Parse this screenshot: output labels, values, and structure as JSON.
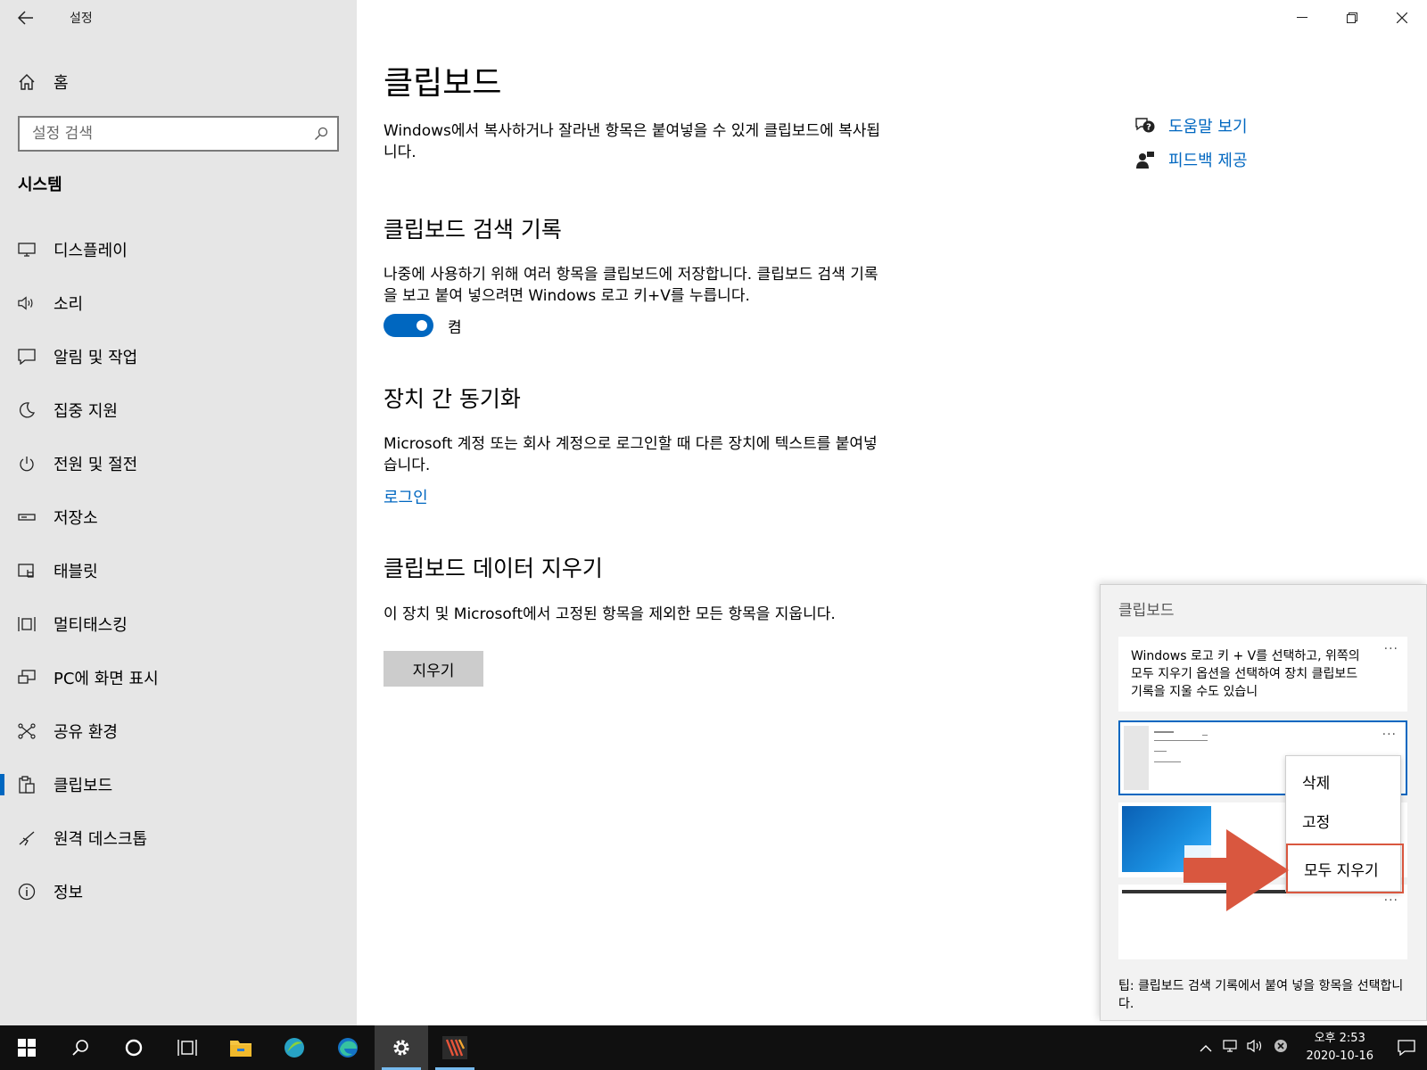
{
  "window": {
    "title": "설정",
    "back_label": "←",
    "minimize": "—",
    "restore": "❐",
    "close": "✕"
  },
  "sidebar": {
    "home_label": "홈",
    "search_placeholder": "설정 검색",
    "section_title": "시스템",
    "items": [
      {
        "label": "디스플레이",
        "icon": "display-icon"
      },
      {
        "label": "소리",
        "icon": "speaker-icon"
      },
      {
        "label": "알림 및 작업",
        "icon": "notification-icon"
      },
      {
        "label": "집중 지원",
        "icon": "moon-icon"
      },
      {
        "label": "전원 및 절전",
        "icon": "power-icon"
      },
      {
        "label": "저장소",
        "icon": "storage-icon"
      },
      {
        "label": "태블릿",
        "icon": "tablet-icon"
      },
      {
        "label": "멀티태스킹",
        "icon": "multitask-icon"
      },
      {
        "label": "PC에 화면 표시",
        "icon": "project-icon"
      },
      {
        "label": "공유 환경",
        "icon": "share-icon"
      },
      {
        "label": "클립보드",
        "icon": "clipboard-icon",
        "active": true
      },
      {
        "label": "원격 데스크톱",
        "icon": "remote-icon"
      },
      {
        "label": "정보",
        "icon": "info-icon"
      }
    ]
  },
  "main": {
    "title": "클립보드",
    "intro": "Windows에서 복사하거나 잘라낸 항목은 붙여넣을 수 있게 클립보드에 복사됩니다.",
    "history": {
      "heading": "클립보드 검색 기록",
      "desc": "나중에 사용하기 위해 여러 항목을 클립보드에 저장합니다. 클립보드 검색 기록을 보고 붙여 넣으려면 Windows 로고 키+V를 누릅니다.",
      "toggle_state": "켬"
    },
    "sync": {
      "heading": "장치 간 동기화",
      "desc": "Microsoft 계정 또는 회사 계정으로 로그인할 때 다른 장치에 텍스트를 붙여넣습니다.",
      "link": "로그인"
    },
    "clear": {
      "heading": "클립보드 데이터 지우기",
      "desc": "이 장치 및 Microsoft에서 고정된 항목을 제외한 모든 항목을 지웁니다.",
      "button": "지우기"
    },
    "help": {
      "help_link": "도움말 보기",
      "feedback_link": "피드백 제공"
    }
  },
  "flyout": {
    "title": "클립보드",
    "first_item_text": "Windows 로고 키 + V를 선택하고, 위쪽의 모두 지우기 옵션을 선택하여 장치 클립보드 기록을 지울 수도 있습니",
    "more": "···",
    "menu": {
      "delete": "삭제",
      "pin": "고정",
      "clear_all": "모두 지우기"
    },
    "tip": "팁: 클립보드 검색 기록에서 붙여 넣을 항목을 선택합니다."
  },
  "taskbar": {
    "clock_time": "오후 2:53",
    "clock_date": "2020-10-16"
  },
  "colors": {
    "accent": "#0067c0",
    "highlight": "#d9573f"
  }
}
